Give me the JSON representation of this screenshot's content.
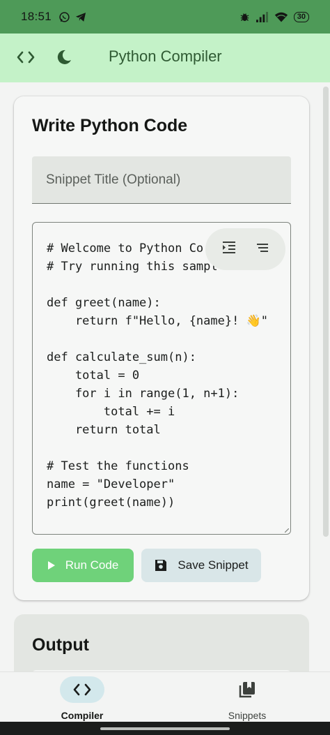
{
  "status_bar": {
    "time": "18:51",
    "battery": "30",
    "left_icons": [
      "whatsapp-icon",
      "telegram-icon"
    ],
    "right_icons": [
      "bug-icon",
      "signal-icon",
      "wifi-icon",
      "battery-icon"
    ]
  },
  "app_bar": {
    "title": "Python Compiler",
    "icons": [
      "code-icon",
      "dark-mode-moon-icon"
    ]
  },
  "editor_card": {
    "heading": "Write Python Code",
    "title_placeholder": "Snippet Title (Optional)",
    "code_lines": [
      "# Welcome to Python Co",
      "# Try running this sampl",
      "",
      "def greet(name):",
      "    return f\"Hello, {name}! 👋\"",
      "",
      "def calculate_sum(n):",
      "    total = 0",
      "    for i in range(1, n+1):",
      "        total += i",
      "    return total",
      "",
      "# Test the functions",
      "name = \"Developer\"",
      "print(greet(name))"
    ],
    "toolbar_icons": [
      "format-indent-icon",
      "format-align-icon"
    ],
    "run_label": "Run Code",
    "save_label": "Save Snippet"
  },
  "output_card": {
    "heading": "Output"
  },
  "bottom_nav": {
    "items": [
      {
        "label": "Compiler",
        "icon": "code-icon",
        "active": true
      },
      {
        "label": "Snippets",
        "icon": "bookmarks-icon",
        "active": false
      }
    ]
  },
  "colors": {
    "status_bar": "#4e9a58",
    "app_bar": "#c4f2c8",
    "run_button": "#6fd27a",
    "save_button": "#d9e6e8",
    "nav_active_pill": "#d3e8ec"
  }
}
